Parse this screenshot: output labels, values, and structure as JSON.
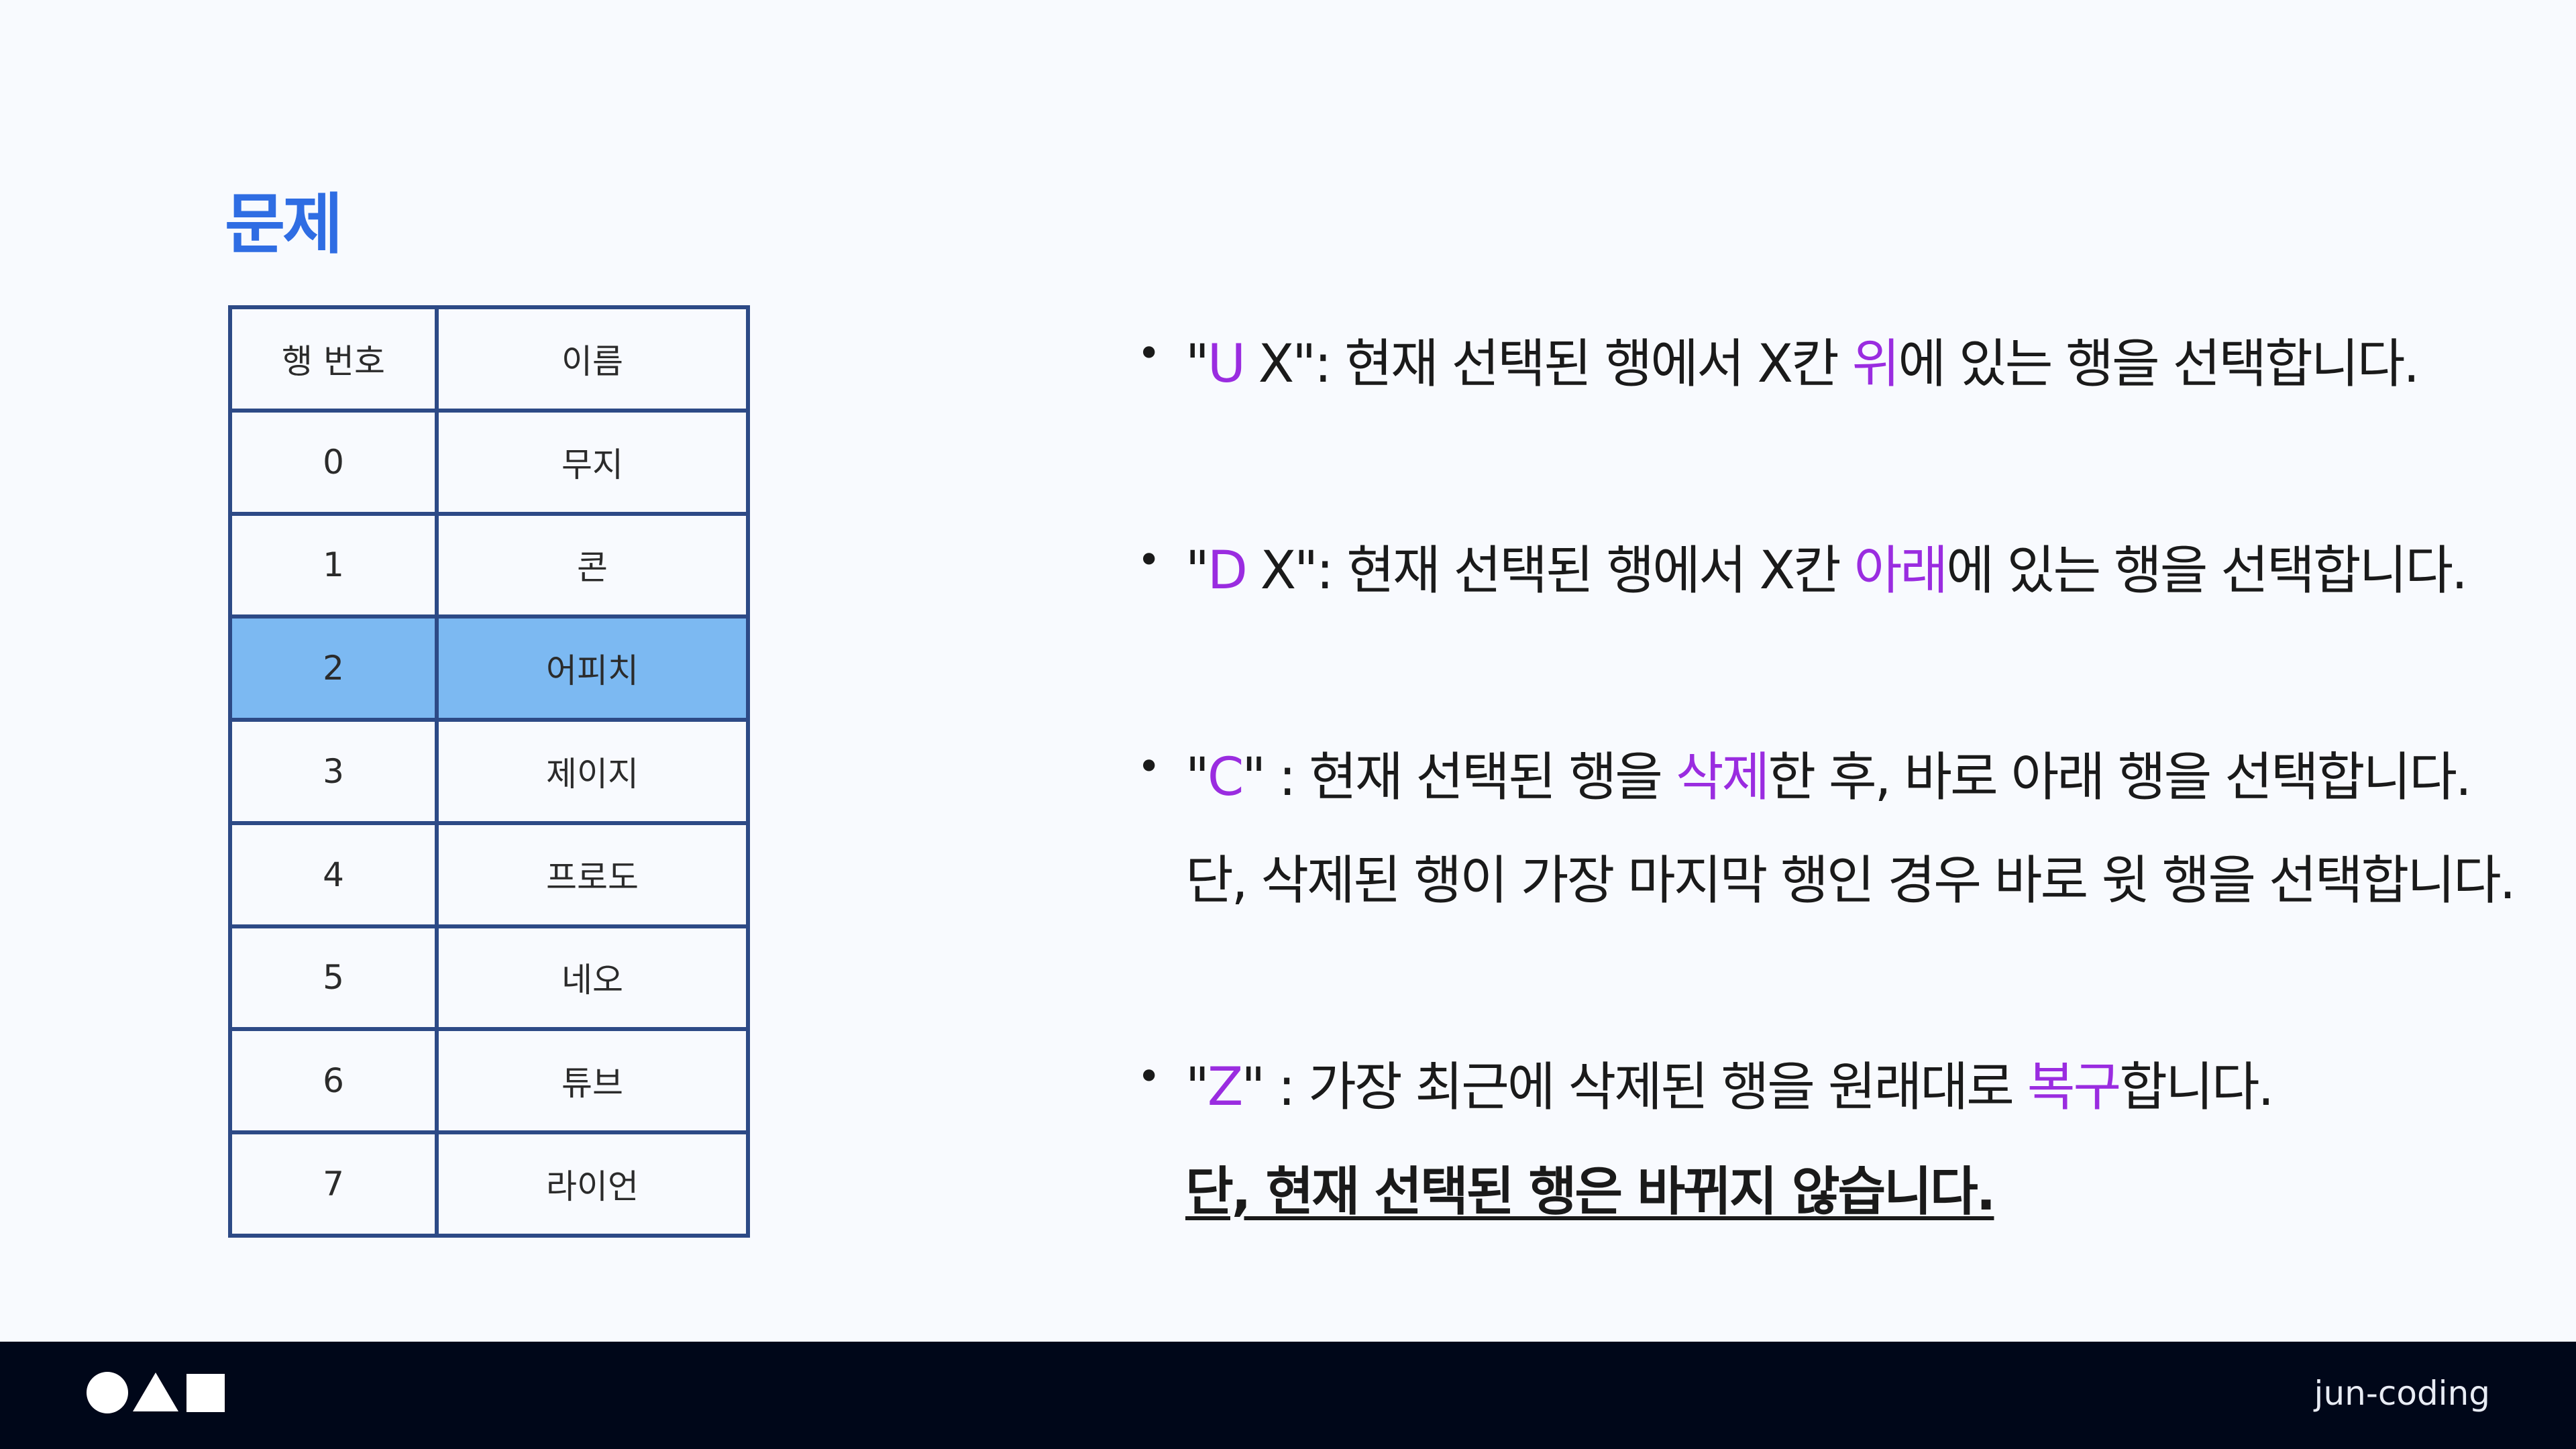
{
  "header": {
    "title": "문제"
  },
  "table": {
    "headers": [
      "행 번호",
      "이름"
    ],
    "selected_row": 2,
    "rows": [
      [
        "0",
        "무지"
      ],
      [
        "1",
        "콘"
      ],
      [
        "2",
        "어피치"
      ],
      [
        "3",
        "제이지"
      ],
      [
        "4",
        "프로도"
      ],
      [
        "5",
        "네오"
      ],
      [
        "6",
        "튜브"
      ],
      [
        "7",
        "라이언"
      ]
    ]
  },
  "rules": {
    "bullet": "•",
    "u": {
      "q1": "\"",
      "cmd": "U",
      "q2": " X\": 현재 선택된 행에서 X칸 ",
      "kw": "위",
      "rest": "에 있는 행을 선택합니다."
    },
    "d": {
      "q1": "\"",
      "cmd": "D",
      "q2": " X\": 현재 선택된 행에서 X칸 ",
      "kw": "아래",
      "rest": "에 있는 행을 선택합니다."
    },
    "c": {
      "q1": "\"",
      "cmd": "C",
      "q2": "\" : 현재 선택된 행을 ",
      "kw": "삭제",
      "rest": "한 후, 바로 아래 행을 선택합니다.",
      "note": "단, 삭제된 행이 가장 마지막 행인 경우 바로 윗 행을 선택합니다."
    },
    "z": {
      "q1": "\"",
      "cmd": "Z",
      "q2": "\" : 가장 최근에 삭제된 행을 원래대로 ",
      "kw": "복구",
      "rest": "합니다.",
      "note": "단, 현재 선택된 행은 바뀌지 않습니다."
    }
  },
  "footer": {
    "brand": "jun-coding"
  },
  "colors": {
    "title": "#2f6de3",
    "accent": "#9a2ce0",
    "table_border": "#2d4a86",
    "selected_row": "#7cb9f2",
    "footer_bg": "#000719"
  }
}
